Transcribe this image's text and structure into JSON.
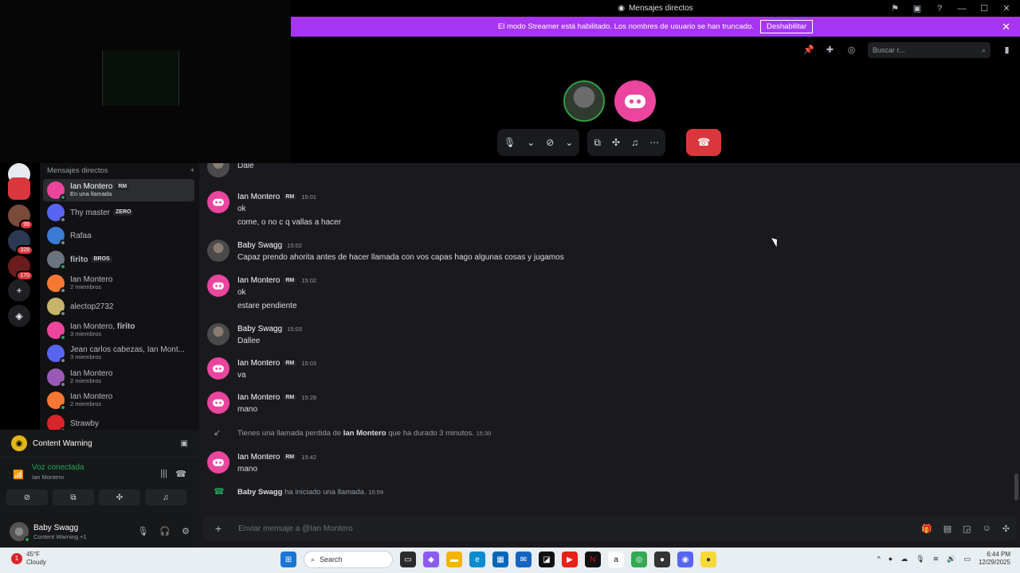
{
  "window": {
    "title": "Mensajes directos"
  },
  "banner": {
    "text": "El modo Streamer está habilitado. Los nombres de usuario se han truncado.",
    "button": "Deshabilitar"
  },
  "call": {
    "search_placeholder": "Buscar r..."
  },
  "sidebar": {
    "header": "Mensajes directos",
    "items": [
      {
        "name": "Ian Montero",
        "tag": "RM",
        "sub": "En una llamada",
        "avatar_color": "#eb459e",
        "active": true
      },
      {
        "name": "Thy master",
        "tag": "ZERO",
        "sub": "",
        "avatar_color": "#5865f2"
      },
      {
        "name": "Rafaa",
        "tag": "",
        "sub": "",
        "avatar_color": "#3a7bd5"
      },
      {
        "name": "𝐟𝐢𝐫𝐢𝐭𝐨",
        "tag": "BROS",
        "sub": "",
        "avatar_color": "#6b7280"
      },
      {
        "name": "Ian Montero",
        "tag": "",
        "sub": "2 miembros",
        "avatar_color": "#f57731"
      },
      {
        "name": "alectop2732",
        "tag": "",
        "sub": "",
        "avatar_color": "#c7b36b"
      },
      {
        "name": "Ian Montero, 𝐟𝐢𝐫𝐢𝐭𝐨",
        "tag": "",
        "sub": "3 miembros",
        "avatar_color": "#eb459e"
      },
      {
        "name": "Jean carlos cabezas, Ian Mont...",
        "tag": "",
        "sub": "3 miembros",
        "avatar_color": "#5865f2"
      },
      {
        "name": "Ian Montero",
        "tag": "",
        "sub": "2 miembros",
        "avatar_color": "#9b59b6"
      },
      {
        "name": "Ian Montero",
        "tag": "",
        "sub": "2 miembros",
        "avatar_color": "#f57731"
      },
      {
        "name": "Strawby",
        "tag": "",
        "sub": "",
        "avatar_color": "#d9242b"
      }
    ]
  },
  "servers": [
    {
      "badge": ""
    },
    {
      "badge": ""
    },
    {
      "badge": "99"
    },
    {
      "badge": "328"
    },
    {
      "badge": "170"
    }
  ],
  "panel": {
    "activity": "Content Warning",
    "voice_status": "Voz conectada",
    "voice_channel": "Ian Montero",
    "user_name": "Baby Swagg",
    "user_sub": "Content Warning +1"
  },
  "messages": [
    {
      "author": "Baby Swagg",
      "time": "",
      "lines": [
        "Dale"
      ],
      "avatar": "photo"
    },
    {
      "author": "Ian Montero",
      "tag": "RM",
      "time": "15:01",
      "lines": [
        "ok",
        "come, o no c q vallas a hacer"
      ],
      "avatar": "pink"
    },
    {
      "author": "Baby Swagg",
      "time": "15:02",
      "lines": [
        "Capaz prendo ahorita antes de hacer llamada con vos capas hago algunas cosas y jugamos"
      ],
      "avatar": "photo"
    },
    {
      "author": "Ian Montero",
      "tag": "RM",
      "time": "15:02",
      "lines": [
        "ok",
        "estare pendiente"
      ],
      "avatar": "pink"
    },
    {
      "author": "Baby Swagg",
      "time": "15:03",
      "lines": [
        "Dallee"
      ],
      "avatar": "photo"
    },
    {
      "author": "Ian Montero",
      "tag": "RM",
      "time": "15:03",
      "lines": [
        "va"
      ],
      "avatar": "pink"
    },
    {
      "author": "Ian Montero",
      "tag": "RM",
      "time": "15:28",
      "lines": [
        "mano"
      ],
      "avatar": "pink"
    },
    {
      "author": "Ian Montero",
      "tag": "RM",
      "time": "15:42",
      "lines": [
        "mano"
      ],
      "avatar": "pink"
    }
  ],
  "system": {
    "missed_prefix": "Tienes una llamada perdida de",
    "missed_user": "Ian Montero",
    "missed_suffix": "que ha durado 3 minutos.",
    "missed_time": "15:30",
    "started_user": "Baby Swagg",
    "started_text": "ha iniciado una llamada.",
    "started_time": "15:59"
  },
  "composer": {
    "placeholder": "Enviar mensaje a @Ian Montero"
  },
  "taskbar": {
    "weather_temp": "45°F",
    "weather_desc": "Cloudy",
    "search": "Search",
    "time": "6:44 PM",
    "date": "12/29/2025"
  }
}
